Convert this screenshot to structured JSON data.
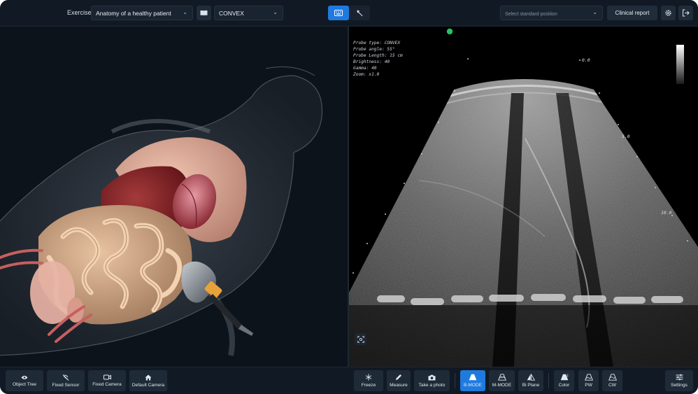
{
  "topbar": {
    "exercise_label": "Exercise:",
    "exercise_value": "Anatomy of a healthy patient",
    "probe_value": "CONVEX",
    "position_placeholder": "Select standard position",
    "report_label": "Clinical report",
    "icons": [
      "book-icon",
      "keyboard-icon",
      "probe-icon",
      "settings-icon",
      "logout-icon"
    ],
    "accent_color": "#1f7ae0"
  },
  "ultrasound": {
    "info_lines": [
      "Probe type: CONVEX",
      "Probe angle: 55°",
      "Probe Length: 15 cm",
      "Brightness: 40",
      "Gamma: 40",
      "Zoom: x1.0"
    ],
    "depth_labels": [
      "0.0",
      "5.0",
      "10.0"
    ],
    "status_color": "#22c55e"
  },
  "bottombar": {
    "left_buttons": [
      {
        "label": "Object Tree",
        "icon": "eye-icon"
      },
      {
        "label": "Fixed Sensor",
        "icon": "sensor-off-icon"
      },
      {
        "label": "Fixed Camera",
        "icon": "camera-icon"
      },
      {
        "label": "Default Camera",
        "icon": "home-icon"
      }
    ],
    "right_buttons": [
      {
        "label": "Freeze",
        "icon": "snowflake-icon"
      },
      {
        "label": "Measure",
        "icon": "pencil-icon"
      },
      {
        "label": "Take a photo",
        "icon": "photo-camera-icon"
      },
      {
        "label": "B-MODE",
        "icon": "b-mode-icon",
        "active": true
      },
      {
        "label": "M-MODE",
        "icon": "m-mode-icon"
      },
      {
        "label": "Bi Plane",
        "icon": "bi-plane-icon"
      },
      {
        "label": "Color",
        "icon": "color-doppler-icon"
      },
      {
        "label": "PW",
        "icon": "pw-icon"
      },
      {
        "label": "CW",
        "icon": "cw-icon"
      },
      {
        "label": "Settings",
        "icon": "sliders-icon"
      }
    ]
  }
}
